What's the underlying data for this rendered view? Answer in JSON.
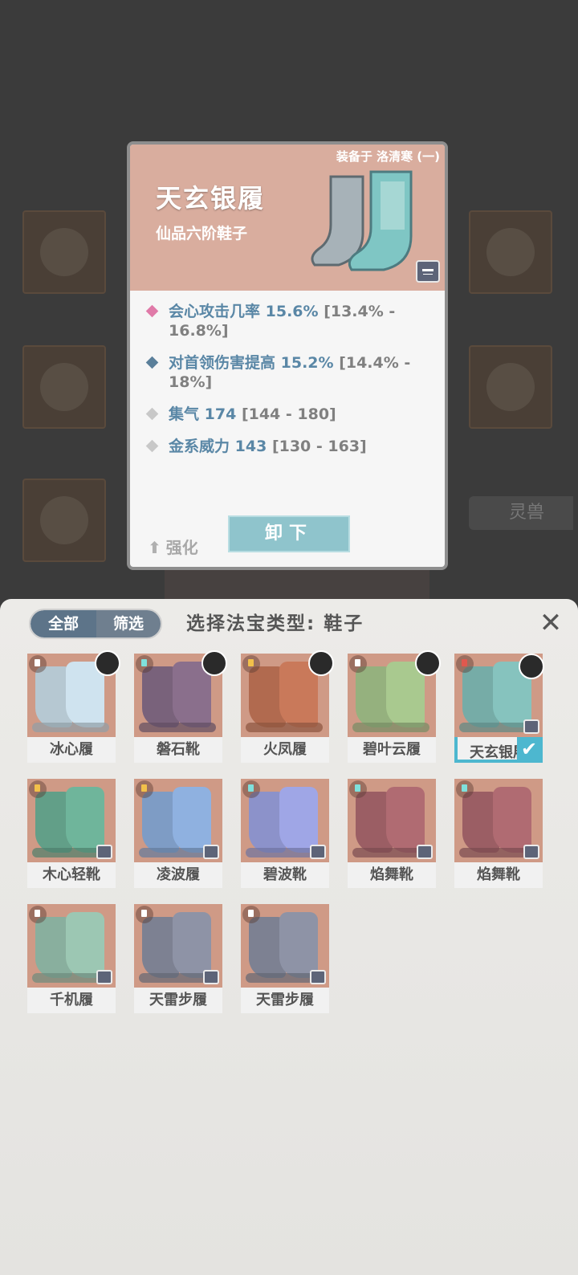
{
  "background": {
    "tab_label": "灵兽"
  },
  "item_card": {
    "equipped_on": "装备于 洛清寒 (一)",
    "name": "天玄银履",
    "grade": "仙品六阶鞋子",
    "art_color": "#7fc6c4",
    "stats": [
      {
        "name": "会心攻击几率",
        "value": "15.6%",
        "range": "[13.4% - 16.8%]",
        "diamond_color": "#e07aa8"
      },
      {
        "name": "对首领伤害提高",
        "value": "15.2%",
        "range": "[14.4% - 18%]",
        "diamond_color": "#5a7f9a"
      },
      {
        "name": "集气",
        "value": "174",
        "range": "[144 - 180]",
        "diamond_color": "#c8c8c8"
      },
      {
        "name": "金系威力",
        "value": "143",
        "range": "[130 - 163]",
        "diamond_color": "#c8c8c8"
      }
    ],
    "enhance_label": "强化",
    "unequip_label": "卸下"
  },
  "panel": {
    "filter_all": "全部",
    "filter_screen": "筛选",
    "title": "选择法宝类型: 鞋子",
    "close_icon": "✕",
    "items": [
      {
        "name": "冰心履",
        "color": "#cfe3ef",
        "tag": "#ffffff",
        "avatar": true,
        "lock": false,
        "selected": false
      },
      {
        "name": "磐石靴",
        "color": "#8a6f8c",
        "tag": "#7fe0dc",
        "avatar": true,
        "lock": false,
        "selected": false
      },
      {
        "name": "火凤履",
        "color": "#c9795a",
        "tag": "#f2c04a",
        "avatar": true,
        "lock": false,
        "selected": false
      },
      {
        "name": "碧叶云履",
        "color": "#a9c98f",
        "tag": "#ffffff",
        "avatar": true,
        "lock": false,
        "selected": false
      },
      {
        "name": "天玄银履",
        "color": "#86c3be",
        "tag": "#e0584e",
        "avatar": true,
        "lock": true,
        "selected": true
      },
      {
        "name": "木心轻靴",
        "color": "#6fb59b",
        "tag": "#f2c04a",
        "avatar": false,
        "lock": true,
        "selected": false
      },
      {
        "name": "凌波履",
        "color": "#8fb1e0",
        "tag": "#f2c04a",
        "avatar": false,
        "lock": true,
        "selected": false
      },
      {
        "name": "碧波靴",
        "color": "#9fa6e6",
        "tag": "#7fe0dc",
        "avatar": false,
        "lock": true,
        "selected": false
      },
      {
        "name": "焰舞靴",
        "color": "#b06b72",
        "tag": "#7fe0dc",
        "avatar": false,
        "lock": true,
        "selected": false
      },
      {
        "name": "焰舞靴",
        "color": "#b06b72",
        "tag": "#7fe0dc",
        "avatar": false,
        "lock": true,
        "selected": false
      },
      {
        "name": "千机履",
        "color": "#9cc7b3",
        "tag": "#ffffff",
        "avatar": false,
        "lock": true,
        "selected": false
      },
      {
        "name": "天雷步履",
        "color": "#8e93a6",
        "tag": "#ffffff",
        "avatar": false,
        "lock": true,
        "selected": false
      },
      {
        "name": "天雷步履",
        "color": "#8e93a6",
        "tag": "#ffffff",
        "avatar": false,
        "lock": true,
        "selected": false
      }
    ]
  }
}
